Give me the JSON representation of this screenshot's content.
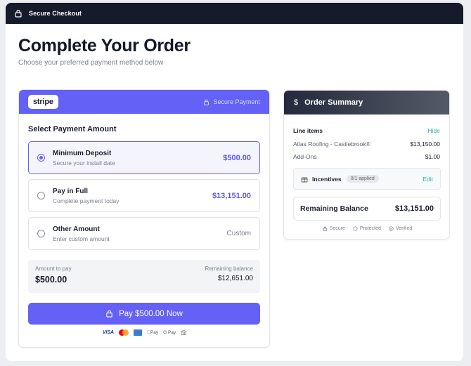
{
  "topbar": {
    "title": "Secure Checkout",
    "icon": "lock-icon"
  },
  "page": {
    "title": "Complete Your Order",
    "subtitle": "Choose your preferred payment method below"
  },
  "payment": {
    "brand": "stripe",
    "secure_label": "Secure Payment",
    "section_title": "Select Payment Amount",
    "options": [
      {
        "title": "Minimum Deposit",
        "desc": "Secure your install date",
        "value": "$500.00",
        "selected": true
      },
      {
        "title": "Pay in Full",
        "desc": "Complete payment today",
        "value": "$13,151.00",
        "selected": false
      },
      {
        "title": "Other Amount",
        "desc": "Enter custom amount",
        "value": "Custom",
        "selected": false
      }
    ],
    "amount_to_pay_label": "Amount to pay",
    "amount_to_pay": "$500.00",
    "remaining_label": "Remaining balance",
    "remaining_value": "$12,651.00",
    "pay_button": "Pay $500.00 Now",
    "methods": {
      "visa": "VISA",
      "apple_pay": "Pay",
      "google_pay": "G Pay"
    }
  },
  "order_summary": {
    "title": "Order Summary",
    "line_items_label": "Line items",
    "hide_label": "Hide",
    "items": [
      {
        "name": "Atlas Roofing - Castlebrook®",
        "price": "$13,150.00"
      },
      {
        "name": "Add-Ons",
        "price": "$1.00"
      }
    ],
    "incentives_label": "Incentives",
    "incentives_badge": "0/1 applied",
    "edit_label": "Edit",
    "remaining_balance_label": "Remaining Balance",
    "remaining_balance": "$13,151.00",
    "trust": [
      "Secure",
      "Protected",
      "Verified"
    ]
  },
  "colors": {
    "accent": "#6461f6",
    "teal": "#2fb7a8",
    "dark": "#161b2b"
  }
}
